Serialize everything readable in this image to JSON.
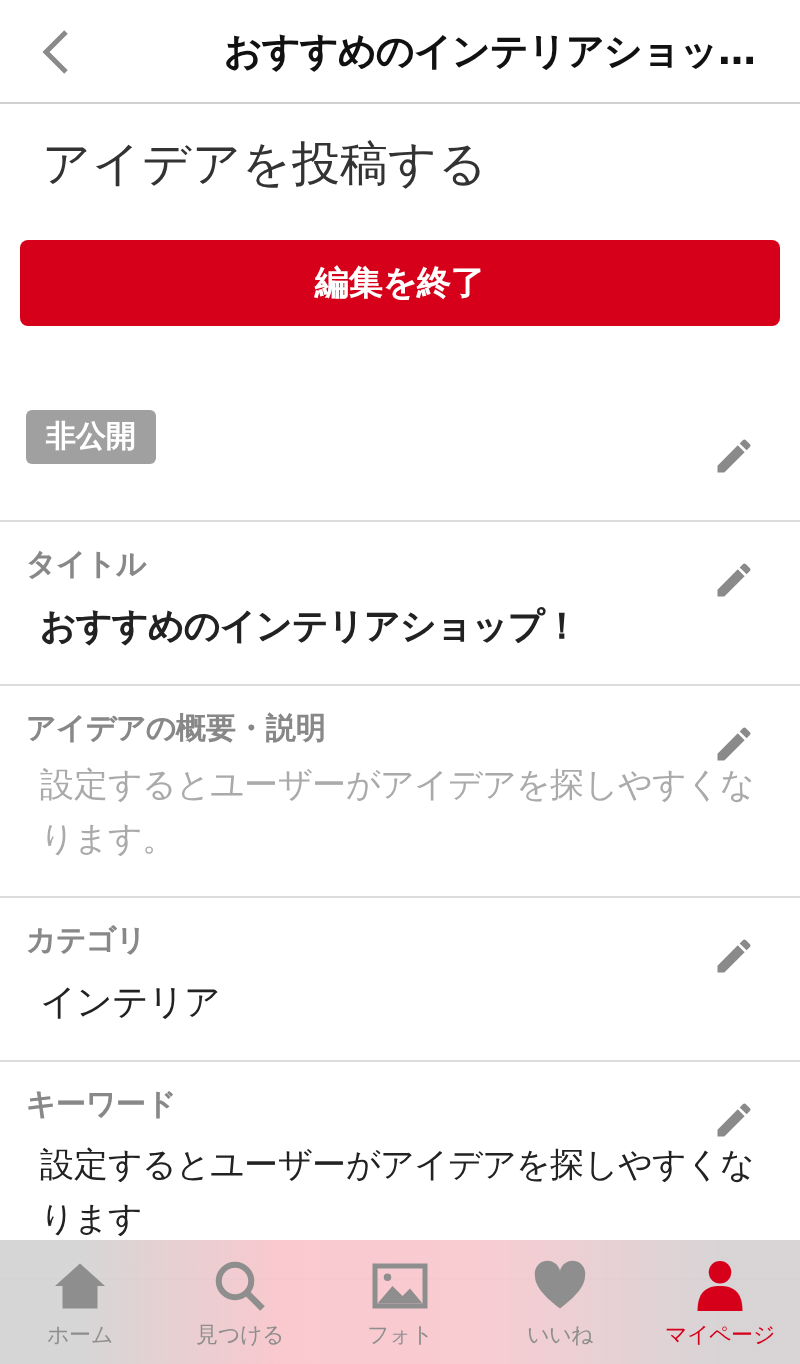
{
  "header": {
    "title": "おすすめのインテリアショッ…"
  },
  "page_title": "アイデアを投稿する",
  "finish_button": "編集を終了",
  "sections": [
    {
      "kind": "badge",
      "badge": "非公開"
    },
    {
      "kind": "field",
      "label": "タイトル",
      "value": "おすすめのインテリアショップ！",
      "bold": true
    },
    {
      "kind": "field",
      "label": "アイデアの概要・説明",
      "placeholder": "設定するとユーザーがアイデアを探しやすくなります。"
    },
    {
      "kind": "field",
      "label": "カテゴリ",
      "value": "インテリア",
      "bold": false
    },
    {
      "kind": "field",
      "label": "キーワード",
      "value": "設定するとユーザーがアイデアを探しやすくなります",
      "bold": false
    }
  ],
  "tabs": [
    {
      "kind": "home",
      "label": "ホーム",
      "selected": false
    },
    {
      "kind": "search",
      "label": "見つける",
      "selected": false
    },
    {
      "kind": "photo",
      "label": "フォト",
      "selected": false
    },
    {
      "kind": "like",
      "label": "いいね",
      "selected": false
    },
    {
      "kind": "mypage",
      "label": "マイページ",
      "selected": true
    }
  ]
}
